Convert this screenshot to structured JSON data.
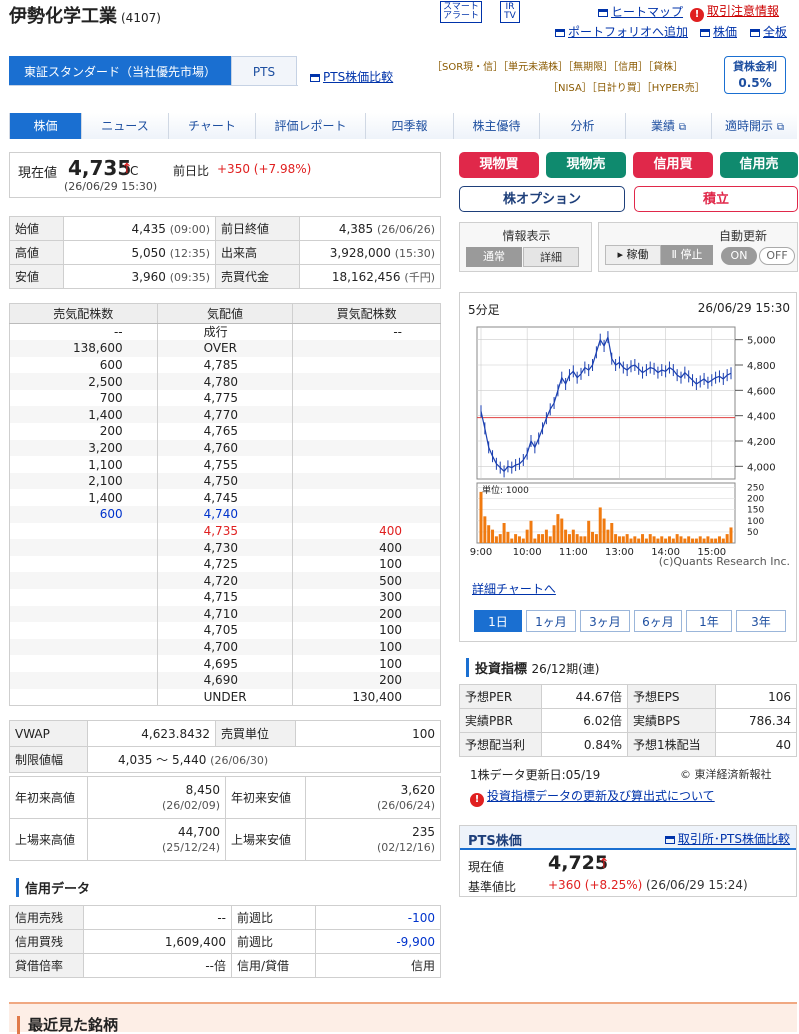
{
  "header": {
    "company_name": "伊勢化学工業",
    "code": "(4107)",
    "smart_alert_1": "スマート",
    "smart_alert_2": "アラート",
    "ir_1": "IR",
    "ir_2": "TV",
    "heatmap": "ヒートマップ",
    "caution": "取引注意情報",
    "portfolio": "ポートフォリオへ追加",
    "stock_price": "株価",
    "board": "全板"
  },
  "market": {
    "selected": "東証スタンダード（当社優先市場）",
    "pts": "PTS",
    "pts_compare": "PTS株価比較",
    "tags_line1": "［SOR現・信］［単元未満株］［無期限］［信用］［貸株］",
    "tags_line2": "［NISA］［日計り買］［HYPER売］",
    "lending_rate_label": "貸株金利",
    "lending_rate_value": "0.5%"
  },
  "tabs": [
    "株価",
    "ニュース",
    "チャート",
    "評価レポート",
    "四季報",
    "株主優待",
    "分析",
    "業績",
    "適時開示"
  ],
  "price": {
    "label": "現在値",
    "value": "4,735",
    "arrow": "↑",
    "flag": "C",
    "change_label": "前日比",
    "change": "+350 (+7.98%)",
    "time": "(26/06/29 15:30)"
  },
  "trade_buttons": {
    "cash_buy": "現物買",
    "cash_sell": "現物売",
    "margin_buy": "信用買",
    "margin_sell": "信用売",
    "option": "株オプション",
    "accumulate": "積立"
  },
  "ohlc": [
    [
      "始値",
      "4,435",
      "(09:00)",
      "前日終値",
      "4,385",
      "(26/06/26)"
    ],
    [
      "高値",
      "5,050",
      "(12:35)",
      "出来高",
      "3,928,000",
      "(15:30)"
    ],
    [
      "安値",
      "3,960",
      "(09:35)",
      "売買代金",
      "18,162,456",
      "(千円)"
    ]
  ],
  "display_panel": {
    "info_label": "情報表示",
    "normal": "通常",
    "detail": "詳細",
    "auto_update": "自動更新",
    "running": "稼働",
    "stopped": "停止",
    "on": "ON",
    "off": "OFF"
  },
  "order_book": {
    "headers": [
      "売気配株数",
      "気配値",
      "買気配株数"
    ],
    "rows": [
      [
        "--",
        "成行",
        "--"
      ],
      [
        "138,600",
        "OVER",
        ""
      ],
      [
        "600",
        "4,785",
        ""
      ],
      [
        "2,500",
        "4,780",
        ""
      ],
      [
        "700",
        "4,775",
        ""
      ],
      [
        "1,400",
        "4,770",
        ""
      ],
      [
        "200",
        "4,765",
        ""
      ],
      [
        "3,200",
        "4,760",
        ""
      ],
      [
        "1,100",
        "4,755",
        ""
      ],
      [
        "2,100",
        "4,750",
        ""
      ],
      [
        "1,400",
        "4,745",
        ""
      ],
      [
        "600",
        "4,740",
        ""
      ],
      [
        "",
        "4,735",
        "400"
      ],
      [
        "",
        "4,730",
        "400"
      ],
      [
        "",
        "4,725",
        "100"
      ],
      [
        "",
        "4,720",
        "500"
      ],
      [
        "",
        "4,715",
        "300"
      ],
      [
        "",
        "4,710",
        "200"
      ],
      [
        "",
        "4,705",
        "100"
      ],
      [
        "",
        "4,700",
        "100"
      ],
      [
        "",
        "4,695",
        "100"
      ],
      [
        "",
        "4,690",
        "200"
      ],
      [
        "",
        "UNDER",
        "130,400"
      ]
    ]
  },
  "stats": {
    "vwap_label": "VWAP",
    "vwap": "4,623.8432",
    "unit_label": "売買単位",
    "unit": "100",
    "limit_label": "制限値幅",
    "limit": "4,035 ～ 5,440",
    "limit_date": "(26/06/30)",
    "ytd_high_label": "年初来高値",
    "ytd_high": "8,450",
    "ytd_high_date": "(26/02/09)",
    "ytd_low_label": "年初来安値",
    "ytd_low": "3,620",
    "ytd_low_date": "(26/06/24)",
    "list_high_label": "上場来高値",
    "list_high": "44,700",
    "list_high_date": "(25/12/24)",
    "list_low_label": "上場来安値",
    "list_low": "235",
    "list_low_date": "(02/12/16)"
  },
  "margin": {
    "title": "信用データ",
    "rows": [
      [
        "信用売残",
        "--",
        "前週比",
        "-100"
      ],
      [
        "信用買残",
        "1,609,400",
        "前週比",
        "-9,900"
      ],
      [
        "貸借倍率",
        "--倍",
        "信用/貸借",
        "信用"
      ]
    ]
  },
  "recent": {
    "title": "最近見た銘柄"
  },
  "chart_panel": {
    "interval": "5分足",
    "datetime": "26/06/29 15:30",
    "detail_link": "詳細チャートへ",
    "credit": "(c)Quants Research Inc.",
    "volume_unit": "単位: 1000",
    "periods": [
      "1日",
      "1ヶ月",
      "3ヶ月",
      "6ヶ月",
      "1年",
      "3年"
    ]
  },
  "chart_data": {
    "type": "line",
    "price_ylim": [
      3900,
      5100
    ],
    "price_yticks": [
      "5,000",
      "4,800",
      "4,600",
      "4,400",
      "4,200",
      "4,000"
    ],
    "prev_close": 4385,
    "volume_yticks": [
      "250",
      "200",
      "150",
      "100",
      "50"
    ],
    "volume_ylim": [
      0,
      270
    ],
    "x_ticks": [
      "9:00",
      "10:00",
      "11:00",
      "13:00",
      "14:00",
      "15:00"
    ],
    "x": [
      "9:00",
      "9:05",
      "9:10",
      "9:15",
      "9:20",
      "9:25",
      "9:30",
      "9:35",
      "9:40",
      "9:45",
      "9:50",
      "9:55",
      "10:00",
      "10:05",
      "10:10",
      "10:15",
      "10:20",
      "10:25",
      "10:30",
      "10:35",
      "10:40",
      "10:45",
      "10:50",
      "10:55",
      "11:00",
      "11:05",
      "11:10",
      "11:15",
      "11:20",
      "11:25",
      "12:30",
      "12:35",
      "12:40",
      "12:45",
      "12:50",
      "12:55",
      "13:00",
      "13:05",
      "13:10",
      "13:15",
      "13:20",
      "13:25",
      "13:30",
      "13:35",
      "13:40",
      "13:45",
      "13:50",
      "13:55",
      "14:00",
      "14:05",
      "14:10",
      "14:15",
      "14:20",
      "14:25",
      "14:30",
      "14:35",
      "14:40",
      "14:45",
      "14:50",
      "14:55",
      "15:00",
      "15:05",
      "15:10",
      "15:15",
      "15:20",
      "15:25"
    ],
    "series": [
      {
        "values": [
          4435,
          4300,
          4150,
          4080,
          4020,
          3990,
          3960,
          4000,
          3990,
          4010,
          4020,
          4050,
          4100,
          4200,
          4150,
          4220,
          4300,
          4380,
          4450,
          4500,
          4600,
          4700,
          4650,
          4720,
          4750,
          4700,
          4730,
          4780,
          4760,
          4800,
          4900,
          5000,
          4950,
          5020,
          4850,
          4800,
          4820,
          4780,
          4760,
          4790,
          4800,
          4770,
          4740,
          4760,
          4780,
          4770,
          4740,
          4760,
          4750,
          4780,
          4760,
          4720,
          4700,
          4740,
          4710,
          4680,
          4650,
          4670,
          4690,
          4660,
          4680,
          4700,
          4710,
          4690,
          4720,
          4735
        ]
      },
      {
        "name": "出来高",
        "values": [
          230,
          120,
          80,
          60,
          30,
          40,
          90,
          50,
          20,
          40,
          30,
          20,
          60,
          100,
          20,
          40,
          40,
          60,
          30,
          80,
          130,
          110,
          60,
          40,
          60,
          40,
          30,
          30,
          100,
          50,
          40,
          160,
          110,
          60,
          90,
          40,
          30,
          30,
          40,
          20,
          30,
          20,
          40,
          20,
          40,
          30,
          20,
          30,
          20,
          30,
          20,
          40,
          30,
          20,
          30,
          20,
          20,
          30,
          20,
          30,
          20,
          20,
          30,
          20,
          40,
          70
        ]
      }
    ]
  },
  "indicators": {
    "title": "投資指標",
    "period": "26/12期(連)",
    "rows": [
      [
        "予想PER",
        "44.67倍",
        "予想EPS",
        "106"
      ],
      [
        "実績PBR",
        "6.02倍",
        "実績BPS",
        "786.34"
      ],
      [
        "予想配当利",
        "0.84%",
        "予想1株配当",
        "40"
      ]
    ],
    "update": "1株データ更新日:05/19",
    "source": "© 東洋経済新報社",
    "notice": "投資指標データの更新及び算出式について"
  },
  "pts_panel": {
    "title": "PTS株価",
    "compare": "取引所･PTS株価比較",
    "price_label": "現在値",
    "price": "4,725",
    "arrow": "↑",
    "base_label": "基準値比",
    "change": "+360 (+8.25%)",
    "time": "(26/06/29 15:24)"
  },
  "colors": {
    "accent": "#1a6fd1",
    "buy": "#e0284a",
    "sell": "#0f8a6e",
    "up": "#e02020"
  }
}
